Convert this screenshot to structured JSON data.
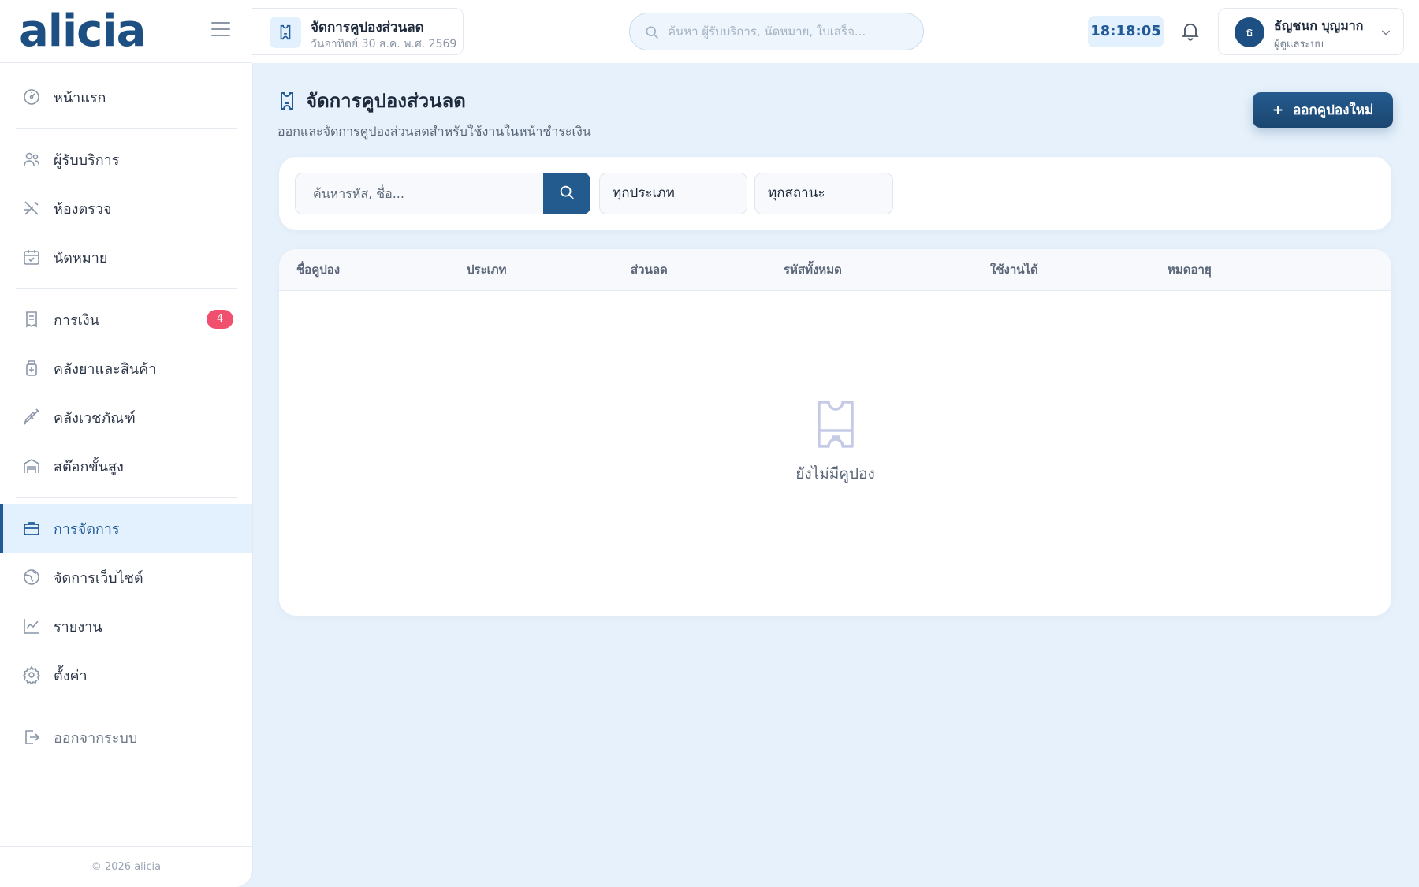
{
  "app": {
    "logo": "alicia"
  },
  "breadcrumb": {
    "title": "จัดการคูปองส่วนลด",
    "date": "วันอาทิตย์ 30 ส.ค. พ.ศ. 2569"
  },
  "global_search": {
    "placeholder": "ค้นหา ผู้รับบริการ, นัดหมาย, ใบเสร็จ..."
  },
  "clock": "18:18:05",
  "user": {
    "initial": "ธ",
    "name": "ธัญชนก บุญมาก",
    "role": "ผู้ดูแลระบบ"
  },
  "sidebar": {
    "items": [
      {
        "label": "หน้าแรก",
        "icon": "dashboard-icon"
      },
      {
        "label": "ผู้รับบริการ",
        "icon": "users-icon"
      },
      {
        "label": "ห้องตรวจ",
        "icon": "stethoscope-icon"
      },
      {
        "label": "นัดหมาย",
        "icon": "calendar-check-icon"
      },
      {
        "label": "การเงิน",
        "icon": "receipt-icon",
        "badge": "4"
      },
      {
        "label": "คลังยาและสินค้า",
        "icon": "medicine-bottle-icon"
      },
      {
        "label": "คลังเวชภัณฑ์",
        "icon": "syringe-icon"
      },
      {
        "label": "สต๊อกขั้นสูง",
        "icon": "warehouse-icon"
      },
      {
        "label": "การจัดการ",
        "icon": "briefcase-icon",
        "active": true
      },
      {
        "label": "จัดการเว็บไซต์",
        "icon": "globe-icon"
      },
      {
        "label": "รายงาน",
        "icon": "chart-line-icon"
      },
      {
        "label": "ตั้งค่า",
        "icon": "gear-icon"
      },
      {
        "label": "ออกจากระบบ",
        "icon": "logout-icon"
      }
    ],
    "copyright": "© 2026 alicia"
  },
  "page": {
    "title": "จัดการคูปองส่วนลด",
    "subtitle": "ออกและจัดการคูปองส่วนลดสำหรับใช้งานในหน้าชำระเงิน",
    "new_button": "ออกคูปองใหม่"
  },
  "filters": {
    "search_placeholder": "ค้นหารหัส, ชื่อ...",
    "type_selected": "ทุกประเภท",
    "status_selected": "ทุกสถานะ"
  },
  "table": {
    "columns": [
      "ชื่อคูปอง",
      "ประเภท",
      "ส่วนลด",
      "รหัสทั้งหมด",
      "ใช้งานได้",
      "หมดอายุ"
    ],
    "rows": [],
    "empty_text": "ยังไม่มีคูปอง"
  },
  "colors": {
    "brand": "#1d4f82",
    "accent_bg": "#e3f0fd",
    "badge": "#f0506e",
    "page_bg": "#e6f1fb"
  }
}
